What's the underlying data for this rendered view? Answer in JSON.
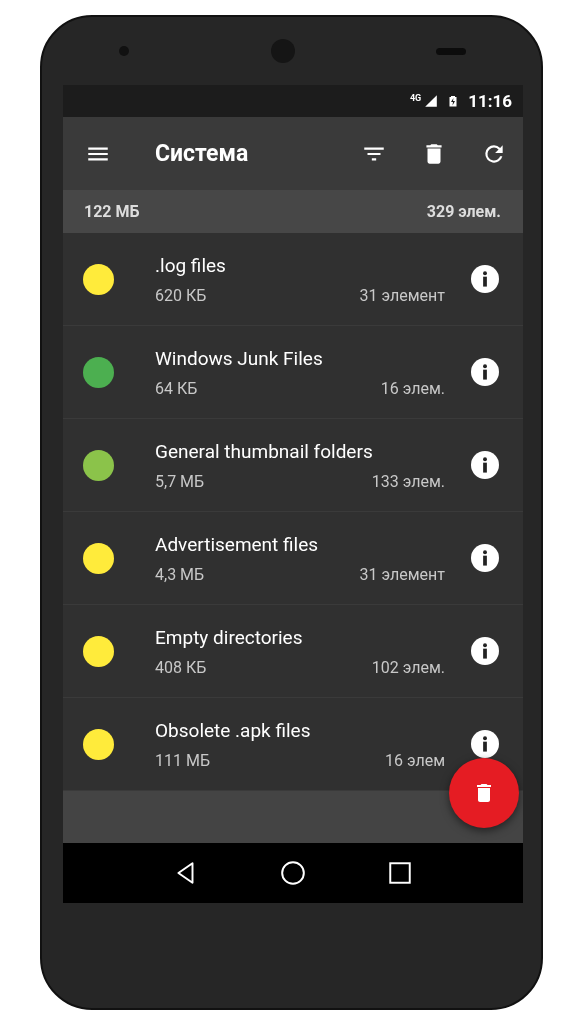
{
  "status_bar": {
    "network": "4G",
    "time": "11:16"
  },
  "toolbar": {
    "title": "Система"
  },
  "summary": {
    "size": "122 МБ",
    "count": "329 элем."
  },
  "items": [
    {
      "name": ".log files",
      "size": "620 КБ",
      "count": "31 элемент",
      "color": "#ffeb3b"
    },
    {
      "name": "Windows Junk Files",
      "size": "64 КБ",
      "count": "16 элем.",
      "color": "#4caf50"
    },
    {
      "name": "General thumbnail folders",
      "size": "5,7 МБ",
      "count": "133 элем.",
      "color": "#8bc34a"
    },
    {
      "name": "Advertisement files",
      "size": "4,3 МБ",
      "count": "31 элемент",
      "color": "#ffeb3b"
    },
    {
      "name": "Empty directories",
      "size": "408 КБ",
      "count": "102 элем.",
      "color": "#ffeb3b"
    },
    {
      "name": "Obsolete .apk files",
      "size": "111 МБ",
      "count": "16 элем",
      "color": "#ffeb3b"
    }
  ]
}
